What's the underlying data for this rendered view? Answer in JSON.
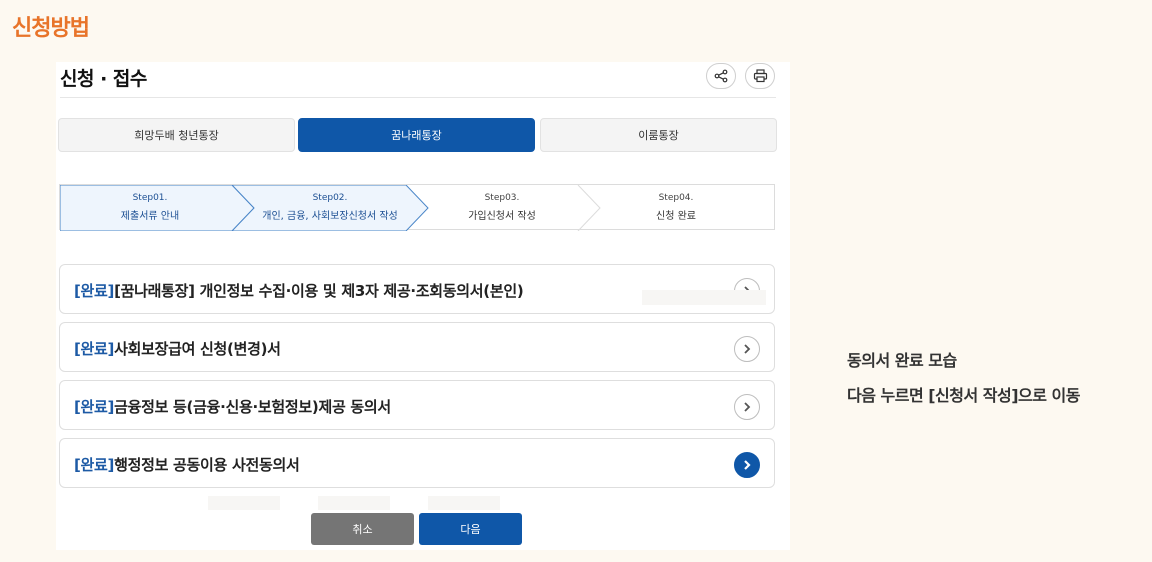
{
  "section_title": "신청방법",
  "panel": {
    "title": "신청 · 접수",
    "share_icon": "share-icon",
    "print_icon": "print-icon"
  },
  "tabs": [
    {
      "label": "희망두배 청년통장",
      "active": false
    },
    {
      "label": "꿈나래통장",
      "active": true
    },
    {
      "label": "이룸통장",
      "active": false
    }
  ],
  "steps": [
    {
      "num": "Step01.",
      "label": "제출서류 안내",
      "active": true
    },
    {
      "num": "Step02.",
      "label": "개인, 금융, 사회보장신청서 작성",
      "active": true
    },
    {
      "num": "Step03.",
      "label": "가입신청서 작성",
      "active": false
    },
    {
      "num": "Step04.",
      "label": "신청 완료",
      "active": false
    }
  ],
  "items": [
    {
      "tag": "[완료]",
      "text": "[꿈나래통장] 개인정보 수집·이용 및 제3자 제공·조회동의서(본인)"
    },
    {
      "tag": "[완료]",
      "text": "사회보장급여 신청(변경)서"
    },
    {
      "tag": "[완료]",
      "text": "금융정보 등(금융·신용·보험정보)제공 동의서"
    },
    {
      "tag": "[완료]",
      "text": "행정정보 공동이용 사전동의서"
    }
  ],
  "buttons": {
    "cancel": "취소",
    "next": "다음"
  },
  "notes": [
    "동의서 완료 모습",
    "다음 누르면 [신청서 작성]으로 이동"
  ],
  "colors": {
    "accent": "#e8742a",
    "primary": "#0f57a8",
    "tag": "#1d5aa5",
    "cancel": "#757575"
  }
}
